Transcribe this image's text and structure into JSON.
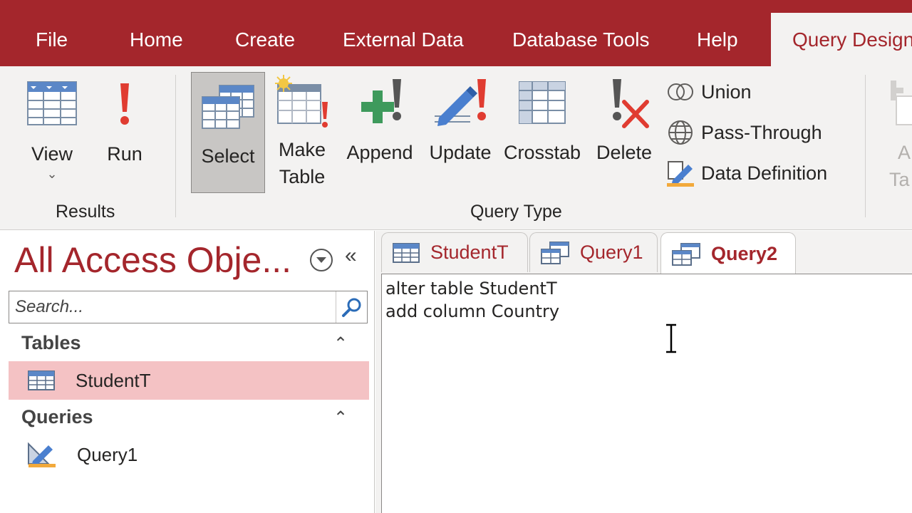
{
  "menu": {
    "tabs": [
      "File",
      "Home",
      "Create",
      "External Data",
      "Database Tools",
      "Help",
      "Query Design"
    ],
    "active_tab": "Query Design"
  },
  "ribbon": {
    "results": {
      "view_label": "View",
      "run_label": "Run",
      "group_label": "Results"
    },
    "query_type": {
      "select_label": "Select",
      "make_table_line1": "Make",
      "make_table_line2": "Table",
      "append_label": "Append",
      "update_label": "Update",
      "crosstab_label": "Crosstab",
      "delete_label": "Delete",
      "union_label": "Union",
      "pass_through_label": "Pass-Through",
      "data_definition_label": "Data Definition",
      "group_label": "Query Type"
    },
    "partial_right_line1": "A",
    "partial_right_line2": "Ta"
  },
  "nav": {
    "title": "All Access Obje...",
    "search_placeholder": "Search...",
    "tables_header": "Tables",
    "tables": [
      "StudentT"
    ],
    "queries_header": "Queries",
    "queries": [
      "Query1"
    ]
  },
  "doc": {
    "tabs": [
      "StudentT",
      "Query1",
      "Query2"
    ],
    "active_tab": "Query2",
    "sql_lines": [
      "alter table StudentT",
      "add column Country"
    ]
  },
  "colors": {
    "accent": "#a4262c",
    "ribbon_bg": "#f3f2f1",
    "selected_nav": "#f4c2c4"
  }
}
